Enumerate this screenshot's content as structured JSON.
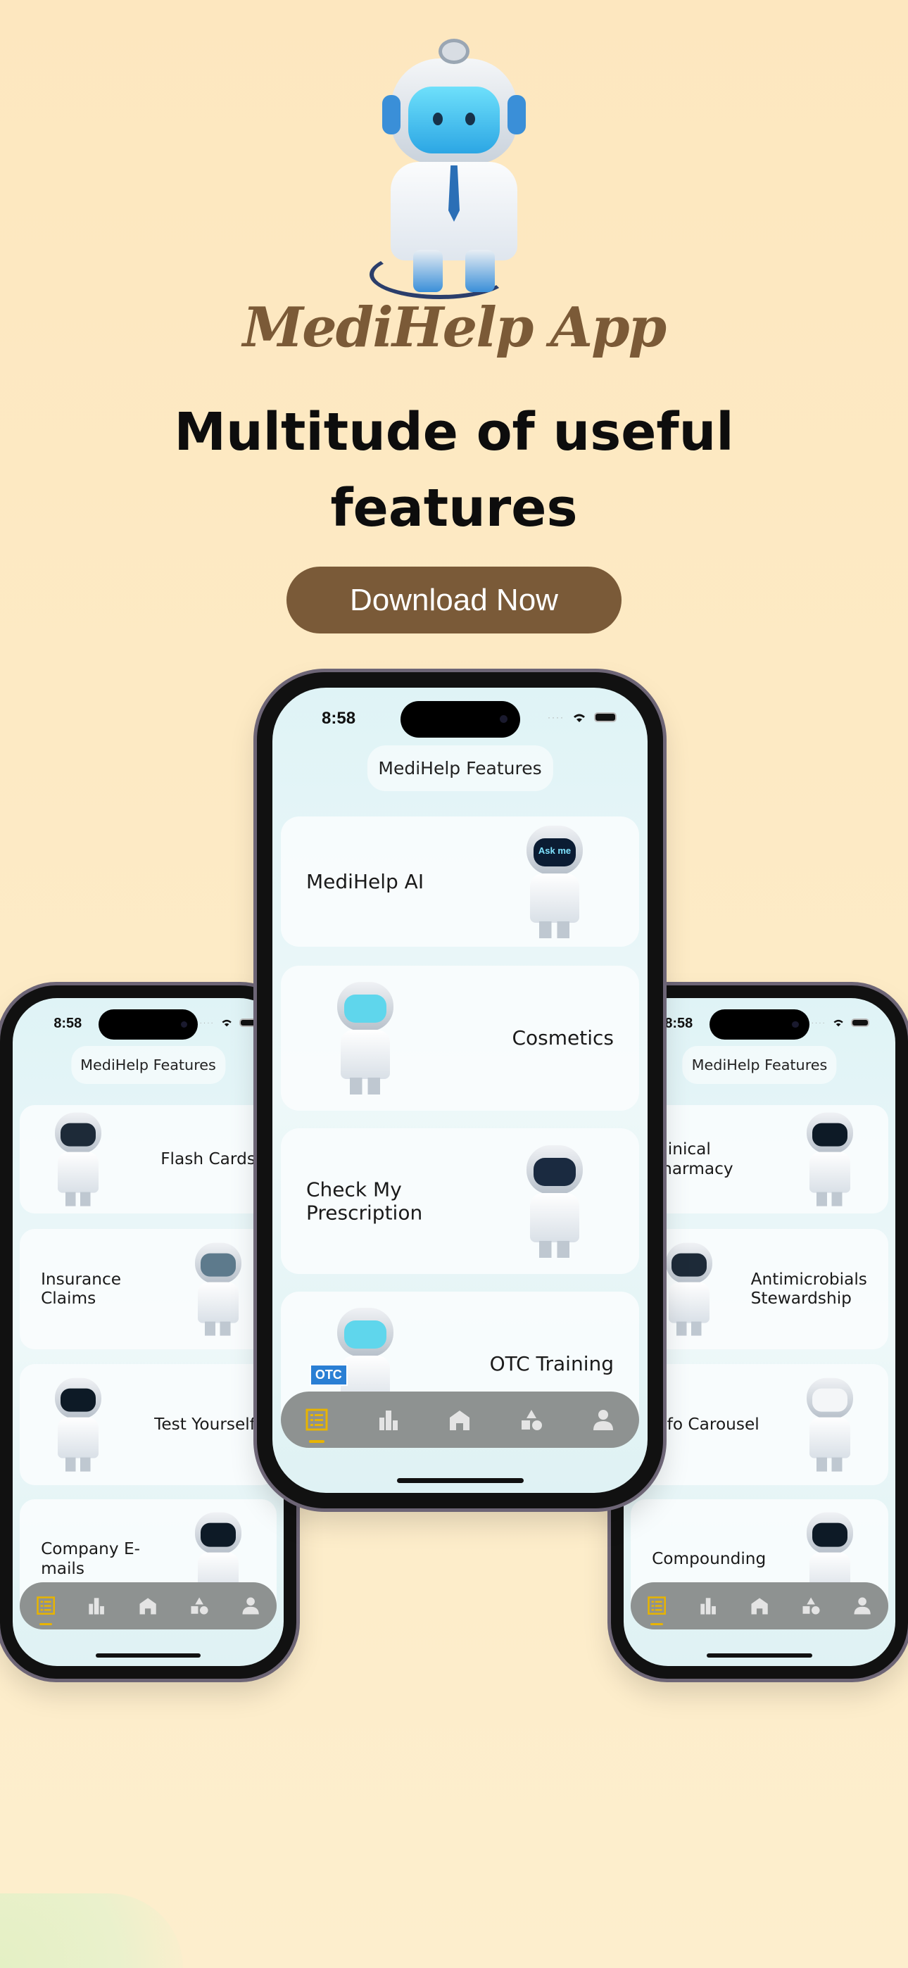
{
  "app_title": "MediHelp App",
  "headline": [
    "Multitude of useful",
    "features"
  ],
  "download_label": "Download Now",
  "colors": {
    "brand_brown": "#7a5a38",
    "nav_active": "#e8b400",
    "nav_bar": "#8e9291"
  },
  "nav_icons": [
    "list-icon",
    "bar-chart-icon",
    "home-icon",
    "shapes-icon",
    "person-icon"
  ],
  "phones": [
    {
      "id": "left",
      "time": "8:58",
      "header": "MediHelp Features",
      "cards": [
        {
          "label": "Flash Cards",
          "image_side": "left",
          "visor": "#1d2a38"
        },
        {
          "label": "Insurance Claims",
          "image_side": "right",
          "visor": "#5d7a8c"
        },
        {
          "label": "Test Yourself",
          "image_side": "left",
          "visor": "#0d1a26"
        },
        {
          "label": "Company E-mails",
          "image_side": "right",
          "visor": "#0d1a26"
        }
      ]
    },
    {
      "id": "center",
      "time": "8:58",
      "header": "MediHelp Features",
      "cards": [
        {
          "label": "MediHelp AI",
          "image_side": "right",
          "visor": "#0b1c33",
          "badge": "Ask me"
        },
        {
          "label": "Cosmetics",
          "image_side": "left",
          "visor": "#5fd6ec"
        },
        {
          "label": "Check My\nPrescription",
          "image_side": "right",
          "visor": "#1a2a40"
        },
        {
          "label": "OTC Training",
          "image_side": "left",
          "visor": "#5fd6ec",
          "badge": "OTC"
        }
      ]
    },
    {
      "id": "right",
      "time": "8:58",
      "header": "MediHelp Features",
      "cards": [
        {
          "label": "Clinical Pharmacy",
          "image_side": "right",
          "visor": "#0d1a26"
        },
        {
          "label": "Antimicrobials\nStewardship",
          "image_side": "left",
          "visor": "#1d2a38"
        },
        {
          "label": "Info Carousel",
          "image_side": "right",
          "visor": "#f4f6f8"
        },
        {
          "label": "Compounding",
          "image_side": "right",
          "visor": "#0d1a26"
        }
      ]
    }
  ]
}
